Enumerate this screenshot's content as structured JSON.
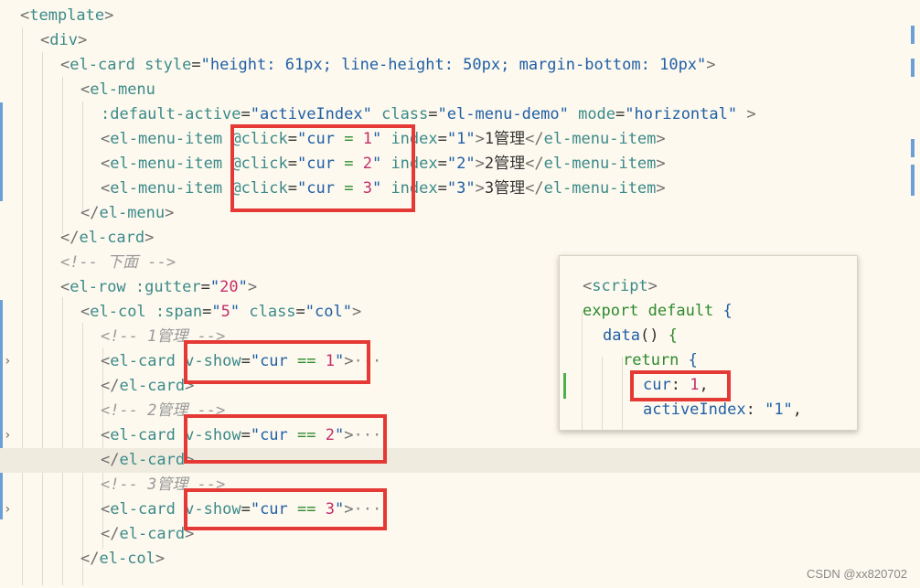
{
  "code_lines": [
    {
      "indent": 0,
      "tokens": [
        [
          "br",
          "<"
        ],
        [
          "tag",
          "template"
        ],
        [
          "br",
          ">"
        ]
      ]
    },
    {
      "indent": 1,
      "tokens": [
        [
          "br",
          "<"
        ],
        [
          "tag",
          "div"
        ],
        [
          "br",
          ">"
        ]
      ]
    },
    {
      "indent": 2,
      "tokens": [
        [
          "br",
          "<"
        ],
        [
          "tag",
          "el-card"
        ],
        [
          "text",
          " "
        ],
        [
          "attr",
          "style"
        ],
        [
          "text",
          "="
        ],
        [
          "str",
          "\"height: 61px; line-height: 50px; margin-bottom: 10px\""
        ],
        [
          "br",
          ">"
        ]
      ]
    },
    {
      "indent": 3,
      "tokens": [
        [
          "br",
          "<"
        ],
        [
          "tag",
          "el-menu"
        ]
      ]
    },
    {
      "indent": 4,
      "tokens": [
        [
          "attr",
          ":default-active"
        ],
        [
          "text",
          "="
        ],
        [
          "str",
          "\"activeIndex\""
        ],
        [
          "text",
          " "
        ],
        [
          "attr",
          "class"
        ],
        [
          "text",
          "="
        ],
        [
          "str",
          "\"el-menu-demo\""
        ],
        [
          "text",
          " "
        ],
        [
          "attr",
          "mode"
        ],
        [
          "text",
          "="
        ],
        [
          "str",
          "\"horizontal\""
        ],
        [
          "text",
          " "
        ],
        [
          "br",
          ">"
        ]
      ]
    },
    {
      "indent": 4,
      "tokens": [
        [
          "br",
          "<"
        ],
        [
          "tag",
          "el-menu-item"
        ],
        [
          "text",
          " "
        ],
        [
          "attr",
          "@click"
        ],
        [
          "text",
          "="
        ],
        [
          "str",
          "\"cur "
        ],
        [
          "op",
          "="
        ],
        [
          "str",
          " "
        ],
        [
          "num",
          "1"
        ],
        [
          "str",
          "\""
        ],
        [
          "text",
          " "
        ],
        [
          "attr",
          "index"
        ],
        [
          "text",
          "="
        ],
        [
          "str",
          "\"1\""
        ],
        [
          "br",
          ">"
        ],
        [
          "text",
          "1管理"
        ],
        [
          "br",
          "</"
        ],
        [
          "tag",
          "el-menu-item"
        ],
        [
          "br",
          ">"
        ]
      ]
    },
    {
      "indent": 4,
      "tokens": [
        [
          "br",
          "<"
        ],
        [
          "tag",
          "el-menu-item"
        ],
        [
          "text",
          " "
        ],
        [
          "attr",
          "@click"
        ],
        [
          "text",
          "="
        ],
        [
          "str",
          "\"cur "
        ],
        [
          "op",
          "="
        ],
        [
          "str",
          " "
        ],
        [
          "num",
          "2"
        ],
        [
          "str",
          "\""
        ],
        [
          "text",
          " "
        ],
        [
          "attr",
          "index"
        ],
        [
          "text",
          "="
        ],
        [
          "str",
          "\"2\""
        ],
        [
          "br",
          ">"
        ],
        [
          "text",
          "2管理"
        ],
        [
          "br",
          "</"
        ],
        [
          "tag",
          "el-menu-item"
        ],
        [
          "br",
          ">"
        ]
      ]
    },
    {
      "indent": 4,
      "tokens": [
        [
          "br",
          "<"
        ],
        [
          "tag",
          "el-menu-item"
        ],
        [
          "text",
          " "
        ],
        [
          "attr",
          "@click"
        ],
        [
          "text",
          "="
        ],
        [
          "str",
          "\"cur "
        ],
        [
          "op",
          "="
        ],
        [
          "str",
          " "
        ],
        [
          "num",
          "3"
        ],
        [
          "str",
          "\""
        ],
        [
          "text",
          " "
        ],
        [
          "attr",
          "index"
        ],
        [
          "text",
          "="
        ],
        [
          "str",
          "\"3\""
        ],
        [
          "br",
          ">"
        ],
        [
          "text",
          "3管理"
        ],
        [
          "br",
          "</"
        ],
        [
          "tag",
          "el-menu-item"
        ],
        [
          "br",
          ">"
        ]
      ]
    },
    {
      "indent": 3,
      "tokens": [
        [
          "br",
          "</"
        ],
        [
          "tag",
          "el-menu"
        ],
        [
          "br",
          ">"
        ]
      ]
    },
    {
      "indent": 2,
      "tokens": [
        [
          "br",
          "</"
        ],
        [
          "tag",
          "el-card"
        ],
        [
          "br",
          ">"
        ]
      ]
    },
    {
      "indent": 2,
      "tokens": [
        [
          "cmt",
          "<!-- 下面 -->"
        ]
      ]
    },
    {
      "indent": 2,
      "tokens": [
        [
          "br",
          "<"
        ],
        [
          "tag",
          "el-row"
        ],
        [
          "text",
          " "
        ],
        [
          "attr",
          ":gutter"
        ],
        [
          "text",
          "="
        ],
        [
          "str",
          "\""
        ],
        [
          "num",
          "20"
        ],
        [
          "str",
          "\""
        ],
        [
          "br",
          ">"
        ]
      ]
    },
    {
      "indent": 3,
      "tokens": [
        [
          "br",
          "<"
        ],
        [
          "tag",
          "el-col"
        ],
        [
          "text",
          " "
        ],
        [
          "attr",
          ":span"
        ],
        [
          "text",
          "="
        ],
        [
          "str",
          "\""
        ],
        [
          "num",
          "5"
        ],
        [
          "str",
          "\""
        ],
        [
          "text",
          " "
        ],
        [
          "attr",
          "class"
        ],
        [
          "text",
          "="
        ],
        [
          "str",
          "\"col\""
        ],
        [
          "br",
          ">"
        ]
      ]
    },
    {
      "indent": 4,
      "tokens": [
        [
          "cmt",
          "<!-- 1管理 -->"
        ]
      ]
    },
    {
      "indent": 4,
      "fold": true,
      "tokens": [
        [
          "br",
          "<"
        ],
        [
          "tag",
          "el-card"
        ],
        [
          "text",
          " "
        ],
        [
          "attr",
          "v-show"
        ],
        [
          "text",
          "="
        ],
        [
          "str",
          "\"cur "
        ],
        [
          "op",
          "=="
        ],
        [
          "str",
          " "
        ],
        [
          "num",
          "1"
        ],
        [
          "str",
          "\""
        ],
        [
          "br",
          ">"
        ],
        [
          "dots",
          "···"
        ]
      ]
    },
    {
      "indent": 4,
      "tokens": [
        [
          "br",
          "</"
        ],
        [
          "tag",
          "el-card"
        ],
        [
          "br",
          ">"
        ]
      ]
    },
    {
      "indent": 4,
      "tokens": [
        [
          "cmt",
          "<!-- 2管理 -->"
        ]
      ]
    },
    {
      "indent": 4,
      "fold": true,
      "tokens": [
        [
          "br",
          "<"
        ],
        [
          "tag",
          "el-card"
        ],
        [
          "text",
          " "
        ],
        [
          "attr",
          "v-show"
        ],
        [
          "text",
          "="
        ],
        [
          "str",
          "\"cur "
        ],
        [
          "op",
          "=="
        ],
        [
          "str",
          " "
        ],
        [
          "num",
          "2"
        ],
        [
          "str",
          "\""
        ],
        [
          "br",
          ">"
        ],
        [
          "dots",
          "···"
        ]
      ]
    },
    {
      "indent": 4,
      "highlight": true,
      "tokens": [
        [
          "br",
          "</"
        ],
        [
          "tag",
          "el-card"
        ],
        [
          "br",
          ">"
        ]
      ]
    },
    {
      "indent": 4,
      "tokens": [
        [
          "cmt",
          "<!-- 3管理 -->"
        ]
      ]
    },
    {
      "indent": 4,
      "fold": true,
      "tokens": [
        [
          "br",
          "<"
        ],
        [
          "tag",
          "el-card"
        ],
        [
          "text",
          " "
        ],
        [
          "attr",
          "v-show"
        ],
        [
          "text",
          "="
        ],
        [
          "str",
          "\"cur "
        ],
        [
          "op",
          "=="
        ],
        [
          "str",
          " "
        ],
        [
          "num",
          "3"
        ],
        [
          "str",
          "\""
        ],
        [
          "br",
          ">"
        ],
        [
          "dots",
          "···"
        ]
      ]
    },
    {
      "indent": 4,
      "tokens": [
        [
          "br",
          "</"
        ],
        [
          "tag",
          "el-card"
        ],
        [
          "br",
          ">"
        ]
      ]
    },
    {
      "indent": 3,
      "tokens": [
        [
          "br",
          "</"
        ],
        [
          "tag",
          "el-col"
        ],
        [
          "br",
          ">"
        ]
      ]
    }
  ],
  "popup_lines": [
    {
      "indent": 0,
      "tokens": []
    },
    {
      "indent": 1,
      "tokens": [
        [
          "br",
          "<"
        ],
        [
          "tag",
          "script"
        ],
        [
          "br",
          ">"
        ]
      ]
    },
    {
      "indent": 1,
      "tokens": [
        [
          "kw",
          "export default"
        ],
        [
          "plain",
          " "
        ],
        [
          "fn",
          "{"
        ]
      ]
    },
    {
      "indent": 2,
      "tokens": [
        [
          "fn",
          "data"
        ],
        [
          "plain",
          "() "
        ],
        [
          "kw",
          "{"
        ]
      ]
    },
    {
      "indent": 3,
      "tokens": [
        [
          "kw",
          "return"
        ],
        [
          "plain",
          " "
        ],
        [
          "fn",
          "{"
        ]
      ]
    },
    {
      "indent": 4,
      "tokens": [
        [
          "str",
          "cur"
        ],
        [
          "plain",
          ": "
        ],
        [
          "num",
          "1"
        ],
        [
          "plain",
          ","
        ]
      ]
    },
    {
      "indent": 4,
      "tokens": [
        [
          "str",
          "activeIndex"
        ],
        [
          "plain",
          ": "
        ],
        [
          "str",
          "\"1\""
        ],
        [
          "plain",
          ","
        ]
      ]
    }
  ],
  "watermark": "CSDN @xx820702"
}
